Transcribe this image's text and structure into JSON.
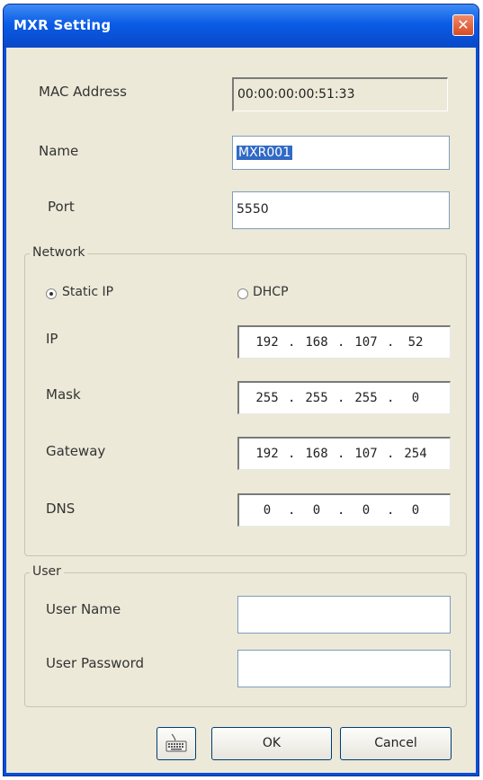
{
  "window": {
    "title": "MXR Setting",
    "close_symbol": "✕"
  },
  "device": {
    "mac_label": "MAC Address",
    "mac_value": "00:00:00:00:51:33",
    "name_label": "Name",
    "name_value": "MXR001",
    "port_label": "Port",
    "port_value": "5550"
  },
  "network": {
    "legend": "Network",
    "static_label": "Static IP",
    "dhcp_label": "DHCP",
    "mode_selected": "Static IP",
    "ip_label": "IP",
    "ip": [
      "192",
      "168",
      "107",
      "52"
    ],
    "mask_label": "Mask",
    "mask": [
      "255",
      "255",
      "255",
      "0"
    ],
    "gateway_label": "Gateway",
    "gateway": [
      "192",
      "168",
      "107",
      "254"
    ],
    "dns_label": "DNS",
    "dns": [
      "0",
      "0",
      "0",
      "0"
    ]
  },
  "user": {
    "legend": "User",
    "name_label": "User Name",
    "name_value": "",
    "password_label": "User Password",
    "password_value": ""
  },
  "buttons": {
    "ok": "OK",
    "cancel": "Cancel"
  },
  "colors": {
    "titlebar": "#0a5ce6",
    "close": "#d84b22",
    "dialog_bg": "#ece9d8"
  }
}
